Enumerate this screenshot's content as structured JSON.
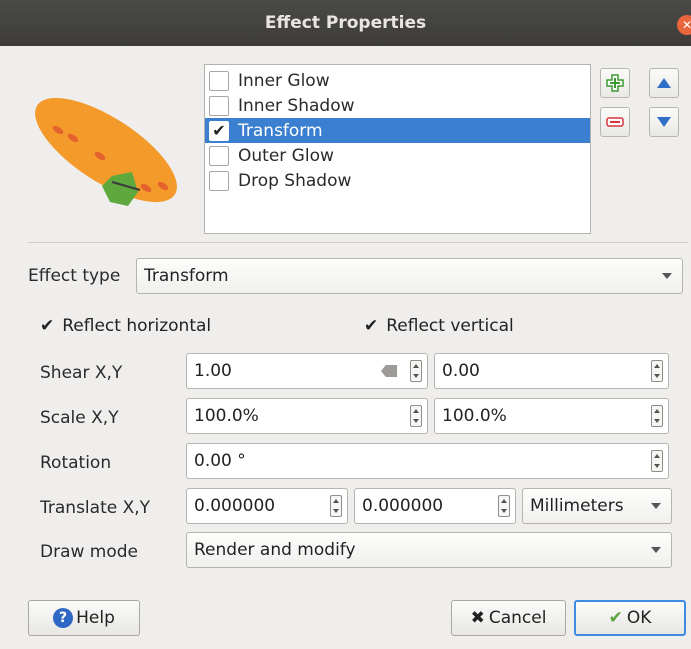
{
  "window": {
    "title": "Effect Properties"
  },
  "effects": [
    {
      "label": "Inner Glow",
      "checked": false,
      "selected": false
    },
    {
      "label": "Inner Shadow",
      "checked": false,
      "selected": false
    },
    {
      "label": "Transform",
      "checked": true,
      "selected": true
    },
    {
      "label": "Outer Glow",
      "checked": false,
      "selected": false
    },
    {
      "label": "Drop Shadow",
      "checked": false,
      "selected": false
    }
  ],
  "tools": {
    "add_icon": "plus-icon",
    "remove_icon": "minus-icon",
    "up_icon": "arrow-up-icon",
    "down_icon": "arrow-down-icon"
  },
  "form": {
    "effect_type_label": "Effect type",
    "effect_type_value": "Transform",
    "reflect_horizontal_label": "Reflect horizontal",
    "reflect_horizontal_checked": true,
    "reflect_vertical_label": "Reflect vertical",
    "reflect_vertical_checked": true,
    "shear_label": "Shear X,Y",
    "shear_x": "1.00",
    "shear_y": "0.00",
    "scale_label": "Scale X,Y",
    "scale_x": "100.0%",
    "scale_y": "100.0%",
    "rotation_label": "Rotation",
    "rotation_value": "0.00 °",
    "translate_label": "Translate X,Y",
    "translate_x": "0.000000",
    "translate_y": "0.000000",
    "translate_unit": "Millimeters",
    "draw_mode_label": "Draw mode",
    "draw_mode_value": "Render and modify"
  },
  "buttons": {
    "help": "Help",
    "cancel": "Cancel",
    "ok": "OK"
  },
  "colors": {
    "selection": "#3a7fd0",
    "preview_fill": "#f39a2b",
    "preview_leaf": "#5fa83d",
    "add": "#3d9a32",
    "remove": "#d8343d",
    "arrow": "#2f6fc6"
  }
}
